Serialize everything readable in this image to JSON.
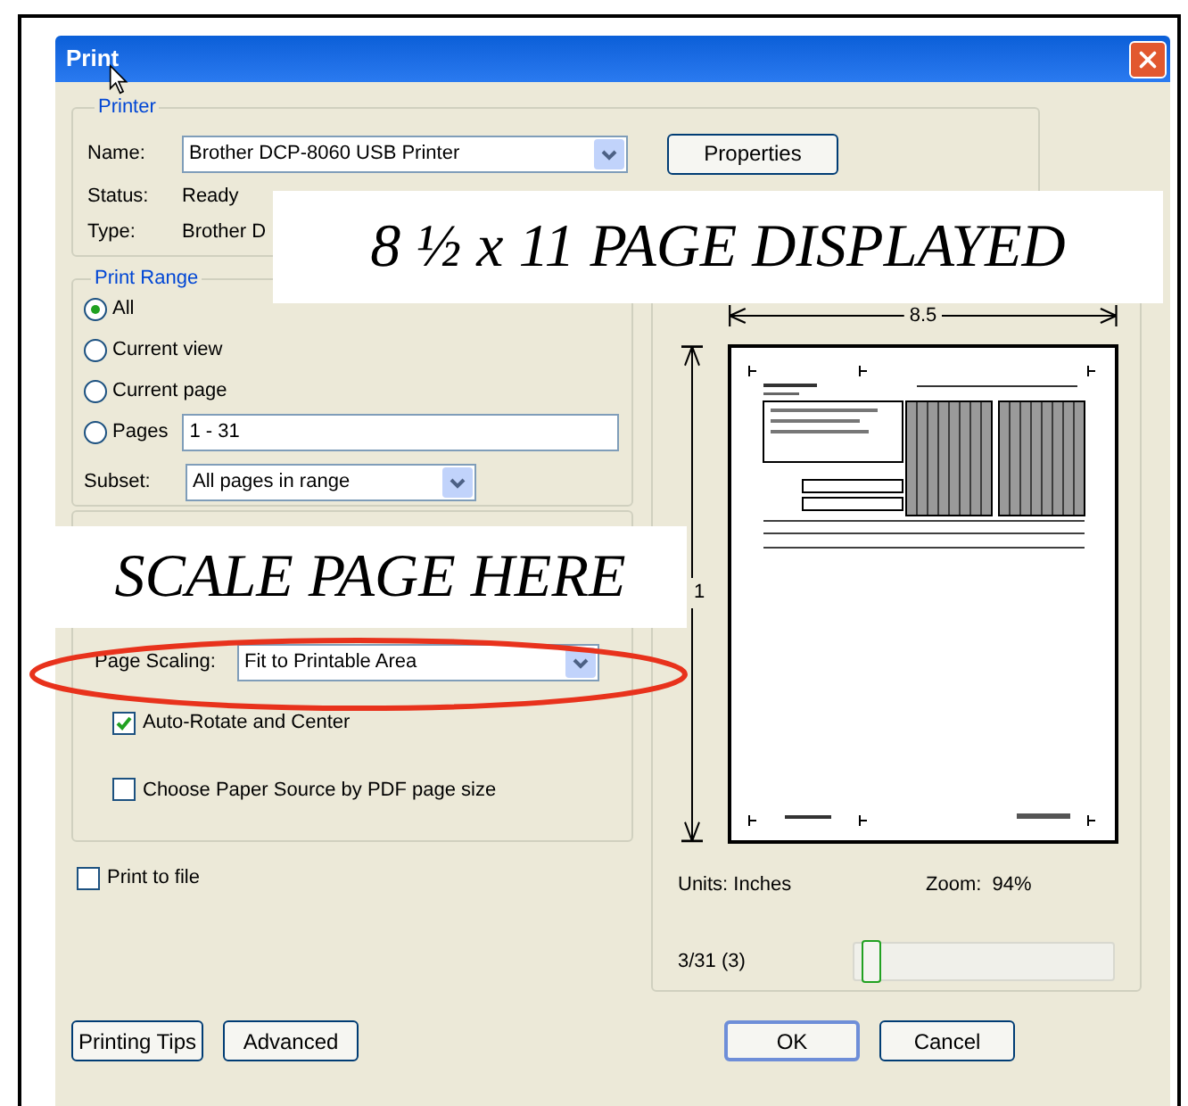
{
  "window": {
    "title": "Print"
  },
  "printer": {
    "legend": "Printer",
    "name_label": "Name:",
    "name_value": "Brother DCP-8060 USB Printer",
    "properties_button": "Properties",
    "status_label": "Status:",
    "status_value": "Ready",
    "type_label": "Type:",
    "type_value": "Brother D"
  },
  "print_range": {
    "legend": "Print Range",
    "options": [
      {
        "label": "All",
        "selected": true
      },
      {
        "label": "Current view",
        "selected": false
      },
      {
        "label": "Current page",
        "selected": false
      },
      {
        "label": "Pages",
        "selected": false
      }
    ],
    "pages_value": "1 - 31",
    "subset_label": "Subset:",
    "subset_value": "All pages in range"
  },
  "page_handling": {
    "scaling_label": "Page Scaling:",
    "scaling_value": "Fit to Printable Area",
    "options": [
      {
        "label": "Auto-Rotate and Center",
        "checked": true
      },
      {
        "label": "Choose Paper Source by PDF page size",
        "checked": false
      }
    ]
  },
  "print_to_file": {
    "label": "Print to file",
    "checked": false
  },
  "preview": {
    "width_label": "8.5",
    "height_label": "1",
    "units": "Units: Inches",
    "zoom": "Zoom:  94%",
    "page_counter": "3/31 (3)",
    "slider": {
      "level": 0.03
    }
  },
  "buttons_left": [
    "Printing Tips",
    "Advanced"
  ],
  "buttons_right": [
    {
      "label": "OK",
      "default": true
    },
    {
      "label": "Cancel",
      "default": false
    }
  ],
  "annotations": [
    "8 ½ x 11 PAGE DISPLAYED",
    "SCALE PAGE HERE"
  ]
}
